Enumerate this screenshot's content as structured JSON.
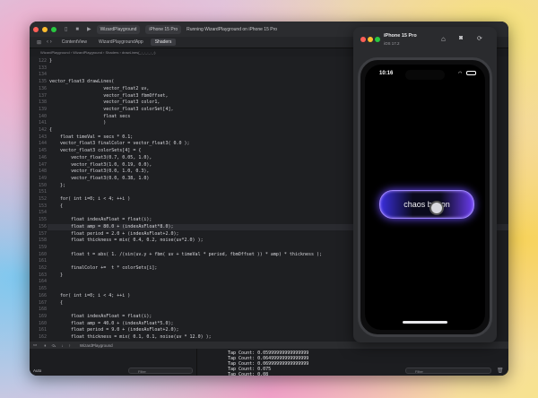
{
  "xcode": {
    "titlebar": {
      "tab1": "WizardPlayground",
      "tab2": "iPhone 15 Pro",
      "status": "Running WizardPlayground on iPhone 15 Pro"
    },
    "tabs": [
      "ContentView",
      "WizardPlaygroundApp",
      "Shaders"
    ],
    "breadcrumb": "WizardPlayground  ›  WizardPlayground  ›  Shaders  ›  drawLines(_:_:_:_:_:)",
    "code_lines": [
      {
        "n": "122",
        "t": "}"
      },
      {
        "n": "133",
        "t": ""
      },
      {
        "n": "134",
        "t": ""
      },
      {
        "n": "135",
        "t": "vector_float3 drawLines("
      },
      {
        "n": "136",
        "t": "                    vector_float2 uv,"
      },
      {
        "n": "137",
        "t": "                    vector_float3 fbmOffset,"
      },
      {
        "n": "138",
        "t": "                    vector_float3 color1,"
      },
      {
        "n": "139",
        "t": "                    vector_float3 colorSet[4],"
      },
      {
        "n": "140",
        "t": "                    float secs"
      },
      {
        "n": "141",
        "t": "                    )"
      },
      {
        "n": "142",
        "t": "{"
      },
      {
        "n": "143",
        "t": "    float timeVal = secs * 0.1;"
      },
      {
        "n": "144",
        "t": "    vector_float3 finalColor = vector_float3( 0.0 );"
      },
      {
        "n": "145",
        "t": "    vector_float3 colorSets[4] = {"
      },
      {
        "n": "146",
        "t": "        vector_float3(0.7, 0.05, 1.0),"
      },
      {
        "n": "147",
        "t": "        vector_float3(1.0, 0.19, 0.0),"
      },
      {
        "n": "148",
        "t": "        vector_float3(0.0, 1.0, 0.3),"
      },
      {
        "n": "149",
        "t": "        vector_float3(0.0, 0.38, 1.0)"
      },
      {
        "n": "150",
        "t": "    };"
      },
      {
        "n": "151",
        "t": ""
      },
      {
        "n": "152",
        "t": "    for( int i=0; i < 4; ++i )"
      },
      {
        "n": "153",
        "t": "    {"
      },
      {
        "n": "154",
        "t": ""
      },
      {
        "n": "155",
        "t": "        float indexAsFloat = float(i);"
      },
      {
        "n": "156",
        "t": "        float amp = 80.0 + (indexAsFloat*8.0);"
      },
      {
        "n": "157",
        "t": "        float period = 2.0 + (indexAsFloat+2.0);"
      },
      {
        "n": "158",
        "t": "        float thickness = mix( 0.4, 0.2, noise(uv*2.0) );"
      },
      {
        "n": "159",
        "t": ""
      },
      {
        "n": "160",
        "t": "        float t = abs( 1. /(sin(uv.y + fbm( uv + timeVal * period, fbmOffset )) * amp) * thickness );"
      },
      {
        "n": "161",
        "t": ""
      },
      {
        "n": "162",
        "t": "        finalColor +=  t * colorSets[i];"
      },
      {
        "n": "163",
        "t": "    }"
      },
      {
        "n": "164",
        "t": ""
      },
      {
        "n": "165",
        "t": ""
      },
      {
        "n": "166",
        "t": "    for( int i=0; i < 4; ++i )"
      },
      {
        "n": "167",
        "t": "    {"
      },
      {
        "n": "168",
        "t": ""
      },
      {
        "n": "169",
        "t": "        float indexAsFloat = float(i);"
      },
      {
        "n": "160",
        "t": "        float amp = 40.0 + (indexAsFloat*5.0);"
      },
      {
        "n": "161",
        "t": "        float period = 9.0 + (indexAsFloat+2.0);"
      },
      {
        "n": "162",
        "t": "        float thickness = mix( 0.1, 0.1, noise(uv * 12.0) );"
      }
    ],
    "debug": {
      "scheme": "WizardPlayground"
    },
    "console": {
      "auto_label": "Auto",
      "filter_placeholder": "Filter",
      "log_lines": [
        "Tap Count: 0.05999999999999999",
        "Tap Count: 0.06499999999999999",
        "Tap Count: 0.06999999999999999",
        "Tap Count: 0.075",
        "Tap Count: 0.08"
      ]
    }
  },
  "simulator": {
    "device_name": "iPhone 15 Pro",
    "os_version": "iOS 17.2",
    "time": "10:16",
    "button_label": "chaos button"
  }
}
